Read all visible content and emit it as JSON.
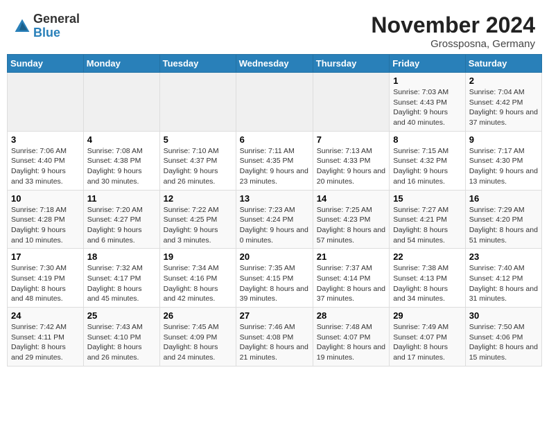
{
  "header": {
    "logo_general": "General",
    "logo_blue": "Blue",
    "month_title": "November 2024",
    "location": "Grossposna, Germany"
  },
  "weekdays": [
    "Sunday",
    "Monday",
    "Tuesday",
    "Wednesday",
    "Thursday",
    "Friday",
    "Saturday"
  ],
  "weeks": [
    [
      {
        "day": "",
        "info": ""
      },
      {
        "day": "",
        "info": ""
      },
      {
        "day": "",
        "info": ""
      },
      {
        "day": "",
        "info": ""
      },
      {
        "day": "",
        "info": ""
      },
      {
        "day": "1",
        "info": "Sunrise: 7:03 AM\nSunset: 4:43 PM\nDaylight: 9 hours and 40 minutes."
      },
      {
        "day": "2",
        "info": "Sunrise: 7:04 AM\nSunset: 4:42 PM\nDaylight: 9 hours and 37 minutes."
      }
    ],
    [
      {
        "day": "3",
        "info": "Sunrise: 7:06 AM\nSunset: 4:40 PM\nDaylight: 9 hours and 33 minutes."
      },
      {
        "day": "4",
        "info": "Sunrise: 7:08 AM\nSunset: 4:38 PM\nDaylight: 9 hours and 30 minutes."
      },
      {
        "day": "5",
        "info": "Sunrise: 7:10 AM\nSunset: 4:37 PM\nDaylight: 9 hours and 26 minutes."
      },
      {
        "day": "6",
        "info": "Sunrise: 7:11 AM\nSunset: 4:35 PM\nDaylight: 9 hours and 23 minutes."
      },
      {
        "day": "7",
        "info": "Sunrise: 7:13 AM\nSunset: 4:33 PM\nDaylight: 9 hours and 20 minutes."
      },
      {
        "day": "8",
        "info": "Sunrise: 7:15 AM\nSunset: 4:32 PM\nDaylight: 9 hours and 16 minutes."
      },
      {
        "day": "9",
        "info": "Sunrise: 7:17 AM\nSunset: 4:30 PM\nDaylight: 9 hours and 13 minutes."
      }
    ],
    [
      {
        "day": "10",
        "info": "Sunrise: 7:18 AM\nSunset: 4:28 PM\nDaylight: 9 hours and 10 minutes."
      },
      {
        "day": "11",
        "info": "Sunrise: 7:20 AM\nSunset: 4:27 PM\nDaylight: 9 hours and 6 minutes."
      },
      {
        "day": "12",
        "info": "Sunrise: 7:22 AM\nSunset: 4:25 PM\nDaylight: 9 hours and 3 minutes."
      },
      {
        "day": "13",
        "info": "Sunrise: 7:23 AM\nSunset: 4:24 PM\nDaylight: 9 hours and 0 minutes."
      },
      {
        "day": "14",
        "info": "Sunrise: 7:25 AM\nSunset: 4:23 PM\nDaylight: 8 hours and 57 minutes."
      },
      {
        "day": "15",
        "info": "Sunrise: 7:27 AM\nSunset: 4:21 PM\nDaylight: 8 hours and 54 minutes."
      },
      {
        "day": "16",
        "info": "Sunrise: 7:29 AM\nSunset: 4:20 PM\nDaylight: 8 hours and 51 minutes."
      }
    ],
    [
      {
        "day": "17",
        "info": "Sunrise: 7:30 AM\nSunset: 4:19 PM\nDaylight: 8 hours and 48 minutes."
      },
      {
        "day": "18",
        "info": "Sunrise: 7:32 AM\nSunset: 4:17 PM\nDaylight: 8 hours and 45 minutes."
      },
      {
        "day": "19",
        "info": "Sunrise: 7:34 AM\nSunset: 4:16 PM\nDaylight: 8 hours and 42 minutes."
      },
      {
        "day": "20",
        "info": "Sunrise: 7:35 AM\nSunset: 4:15 PM\nDaylight: 8 hours and 39 minutes."
      },
      {
        "day": "21",
        "info": "Sunrise: 7:37 AM\nSunset: 4:14 PM\nDaylight: 8 hours and 37 minutes."
      },
      {
        "day": "22",
        "info": "Sunrise: 7:38 AM\nSunset: 4:13 PM\nDaylight: 8 hours and 34 minutes."
      },
      {
        "day": "23",
        "info": "Sunrise: 7:40 AM\nSunset: 4:12 PM\nDaylight: 8 hours and 31 minutes."
      }
    ],
    [
      {
        "day": "24",
        "info": "Sunrise: 7:42 AM\nSunset: 4:11 PM\nDaylight: 8 hours and 29 minutes."
      },
      {
        "day": "25",
        "info": "Sunrise: 7:43 AM\nSunset: 4:10 PM\nDaylight: 8 hours and 26 minutes."
      },
      {
        "day": "26",
        "info": "Sunrise: 7:45 AM\nSunset: 4:09 PM\nDaylight: 8 hours and 24 minutes."
      },
      {
        "day": "27",
        "info": "Sunrise: 7:46 AM\nSunset: 4:08 PM\nDaylight: 8 hours and 21 minutes."
      },
      {
        "day": "28",
        "info": "Sunrise: 7:48 AM\nSunset: 4:07 PM\nDaylight: 8 hours and 19 minutes."
      },
      {
        "day": "29",
        "info": "Sunrise: 7:49 AM\nSunset: 4:07 PM\nDaylight: 8 hours and 17 minutes."
      },
      {
        "day": "30",
        "info": "Sunrise: 7:50 AM\nSunset: 4:06 PM\nDaylight: 8 hours and 15 minutes."
      }
    ]
  ]
}
